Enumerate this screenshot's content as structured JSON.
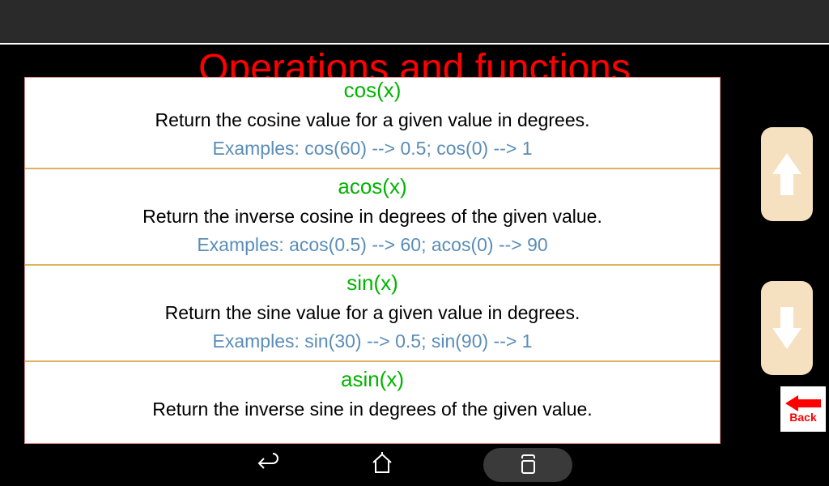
{
  "title": "Operations and functions",
  "entries": [
    {
      "name": "cos(x)",
      "desc": "Return the cosine value for a given value in degrees.",
      "examples": "Examples: cos(60) --> 0.5; cos(0) --> 1"
    },
    {
      "name": "acos(x)",
      "desc": "Return the inverse cosine in degrees of the given value.",
      "examples": "Examples: acos(0.5) --> 60; acos(0) --> 90"
    },
    {
      "name": "sin(x)",
      "desc": "Return the sine value for a given value in degrees.",
      "examples": "Examples: sin(30) --> 0.5; sin(90) --> 1"
    },
    {
      "name": "asin(x)",
      "desc": "Return the inverse sine in degrees of the given value.",
      "examples": ""
    }
  ],
  "back_label": "Back"
}
